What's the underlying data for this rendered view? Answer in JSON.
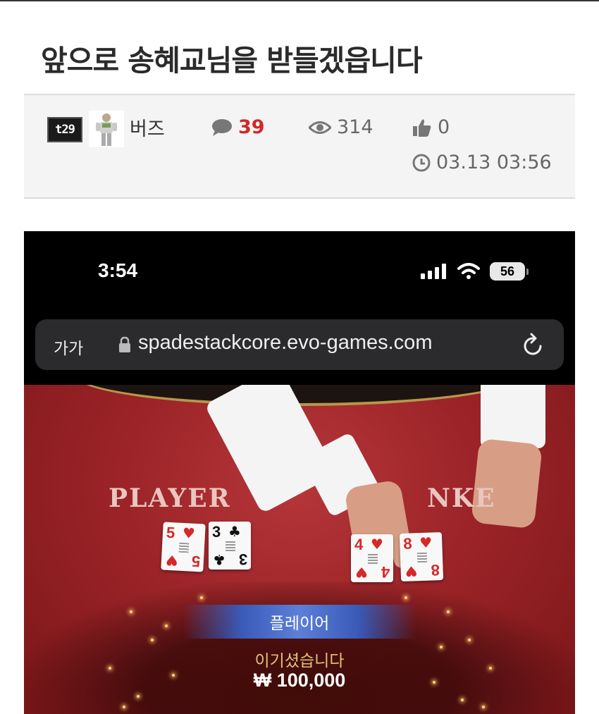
{
  "post": {
    "title": "앞으로 송혜교님을 받들겠읍니다",
    "level_badge": "t29",
    "author": "버즈",
    "comments": "39",
    "views": "314",
    "likes": "0",
    "datetime": "03.13 03:56"
  },
  "screenshot": {
    "status_bar": {
      "time": "3:54",
      "battery": "56"
    },
    "browser": {
      "text_size_label": "가가",
      "url": "spadestackcore.evo-games.com"
    },
    "table": {
      "player_label": "PLAYER",
      "banker_label": "NKE",
      "player_cards": [
        {
          "rank": "5",
          "suit": "♥",
          "color": "red"
        },
        {
          "rank": "3",
          "suit": "♣",
          "color": "black"
        }
      ],
      "banker_cards": [
        {
          "rank": "4",
          "suit": "♥",
          "color": "red"
        },
        {
          "rank": "8",
          "suit": "♥",
          "color": "red"
        }
      ]
    },
    "result": {
      "winner": "플레이어",
      "message": "이기셨습니다",
      "amount": "₩ 100,000"
    }
  },
  "colors": {
    "comment_count": "#d52626",
    "felt": "#9c2428",
    "banner": "#3a5ab8"
  },
  "icons": [
    "comment-icon",
    "eye-icon",
    "thumbs-up-icon",
    "clock-icon",
    "lock-icon",
    "reload-icon",
    "signal-icon",
    "wifi-icon",
    "battery-icon"
  ]
}
